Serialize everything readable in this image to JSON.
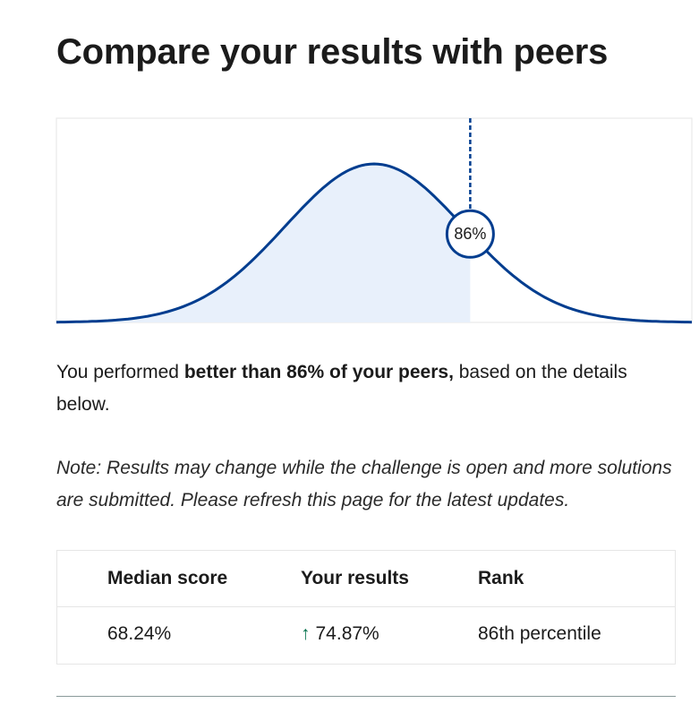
{
  "page": {
    "title": "Compare your results with peers"
  },
  "chart_data": {
    "type": "area",
    "distribution": "normal",
    "marker_percentile": 86,
    "marker_label": "86%",
    "xlim": [
      0,
      1
    ],
    "grid": false,
    "legend": "none",
    "colors": {
      "curve": "#003d8f",
      "fill": "#e8f0fb",
      "background": "#ffffff",
      "marker_line": "#003d8f"
    }
  },
  "summary": {
    "prefix": "You performed ",
    "highlight": "better than 86% of your peers,",
    "suffix": " based on the details below."
  },
  "note": "Note: Results may change while the challenge is open and more solutions are submitted. Please refresh this page for the latest updates.",
  "results_table": {
    "headers": [
      "Median score",
      "Your results",
      "Rank"
    ],
    "row": {
      "median": "68.24%",
      "trend_icon": "arrow-up-icon",
      "trend_glyph": "↑",
      "yours": "74.87%",
      "rank": "86th percentile"
    },
    "trend_color": "#00704a"
  }
}
